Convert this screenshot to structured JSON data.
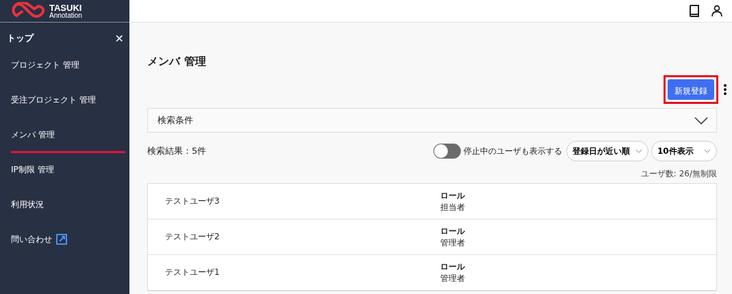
{
  "logo": {
    "name": "TASUKI",
    "sub": "Annotation"
  },
  "sidebar": {
    "title": "トップ",
    "close": "✕",
    "items": [
      {
        "label": "プロジェクト 管理",
        "selected": false,
        "external": false
      },
      {
        "label": "受注プロジェクト 管理",
        "selected": false,
        "external": false
      },
      {
        "label": "メンバ 管理",
        "selected": true,
        "external": false
      },
      {
        "label": "IP制限 管理",
        "selected": false,
        "external": false
      },
      {
        "label": "利用状況",
        "selected": false,
        "external": false
      },
      {
        "label": "問い合わせ",
        "selected": false,
        "external": true
      }
    ]
  },
  "page_title": "メンバ 管理",
  "new_button": {
    "label": "新規登録",
    "highlighted": true
  },
  "search_panel": {
    "label": "検索条件",
    "expanded": false
  },
  "result_count": "検索結果：5件",
  "show_stopped": {
    "label": "停止中のユーザも表示する",
    "on": false
  },
  "sort_select": "登録日が近い順",
  "per_page_select": "10件表示",
  "user_quota": "ユーザ数: 26/無制限",
  "rows": [
    {
      "name": "テストユーザ3",
      "role_label": "ロール",
      "role": "担当者"
    },
    {
      "name": "テストユーザ2",
      "role_label": "ロール",
      "role": "管理者"
    },
    {
      "name": "テストユーザ1",
      "role_label": "ロール",
      "role": "管理者"
    }
  ]
}
